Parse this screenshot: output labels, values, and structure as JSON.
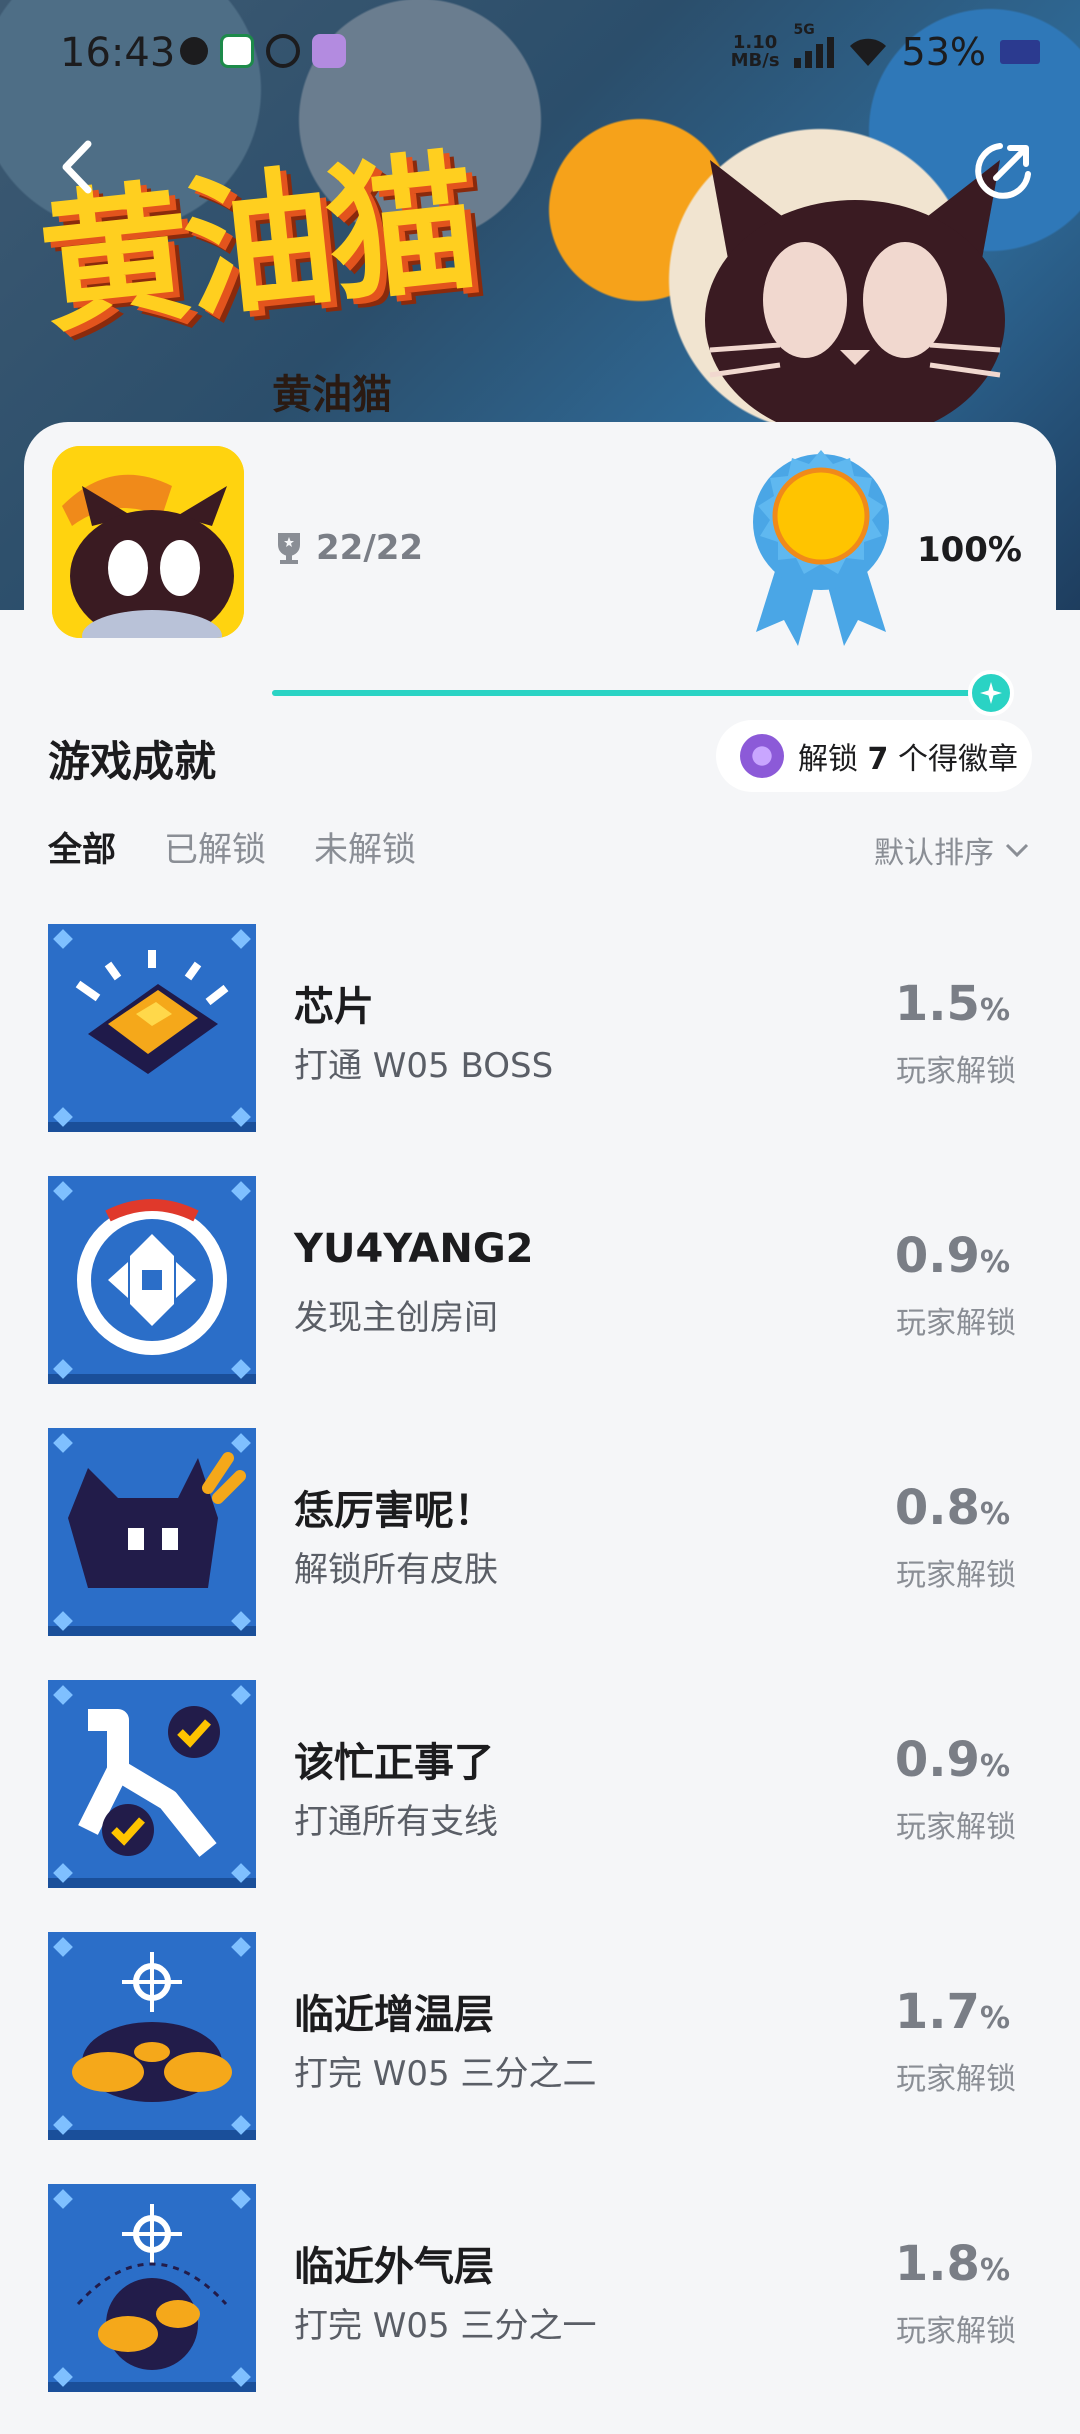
{
  "status_bar": {
    "time": "16:43",
    "net_speed_value": "1.10",
    "net_speed_unit": "MB/s",
    "network": "5G",
    "battery": "53%"
  },
  "hero": {
    "title_art": "黄油猫",
    "game_name": "黄油猫"
  },
  "game_card": {
    "trophy_progress": "22/22",
    "completion": "100%",
    "progress_fraction": 1.0
  },
  "section": {
    "title": "游戏成就",
    "badge_prefix": "解锁",
    "badge_count": "7",
    "badge_suffix": "个得徽章"
  },
  "tabs": [
    {
      "label": "全部",
      "active": true
    },
    {
      "label": "已解锁",
      "active": false
    },
    {
      "label": "未解锁",
      "active": false
    }
  ],
  "sort_label": "默认排序",
  "achievements": [
    {
      "name": "芯片",
      "desc": "打通 W05 BOSS",
      "rate": "1.5",
      "rate_unit": "%",
      "rate_label": "玩家解锁",
      "icon": "chip-icon"
    },
    {
      "name": "YU4YANG2",
      "desc": "发现主创房间",
      "rate": "0.9",
      "rate_unit": "%",
      "rate_label": "玩家解锁",
      "icon": "dpad-icon"
    },
    {
      "name": "恁厉害呢！",
      "desc": "解锁所有皮肤",
      "rate": "0.8",
      "rate_unit": "%",
      "rate_label": "玩家解锁",
      "icon": "cat-icon"
    },
    {
      "name": "该忙正事了",
      "desc": "打通所有支线",
      "rate": "0.9",
      "rate_unit": "%",
      "rate_label": "玩家解锁",
      "icon": "branch-check-icon"
    },
    {
      "name": "临近增温层",
      "desc": "打完 W05 三分之二",
      "rate": "1.7",
      "rate_unit": "%",
      "rate_label": "玩家解锁",
      "icon": "planet-target-icon"
    },
    {
      "name": "临近外气层",
      "desc": "打完 W05 三分之一",
      "rate": "1.8",
      "rate_unit": "%",
      "rate_label": "玩家解锁",
      "icon": "planet-orbit-icon"
    }
  ]
}
